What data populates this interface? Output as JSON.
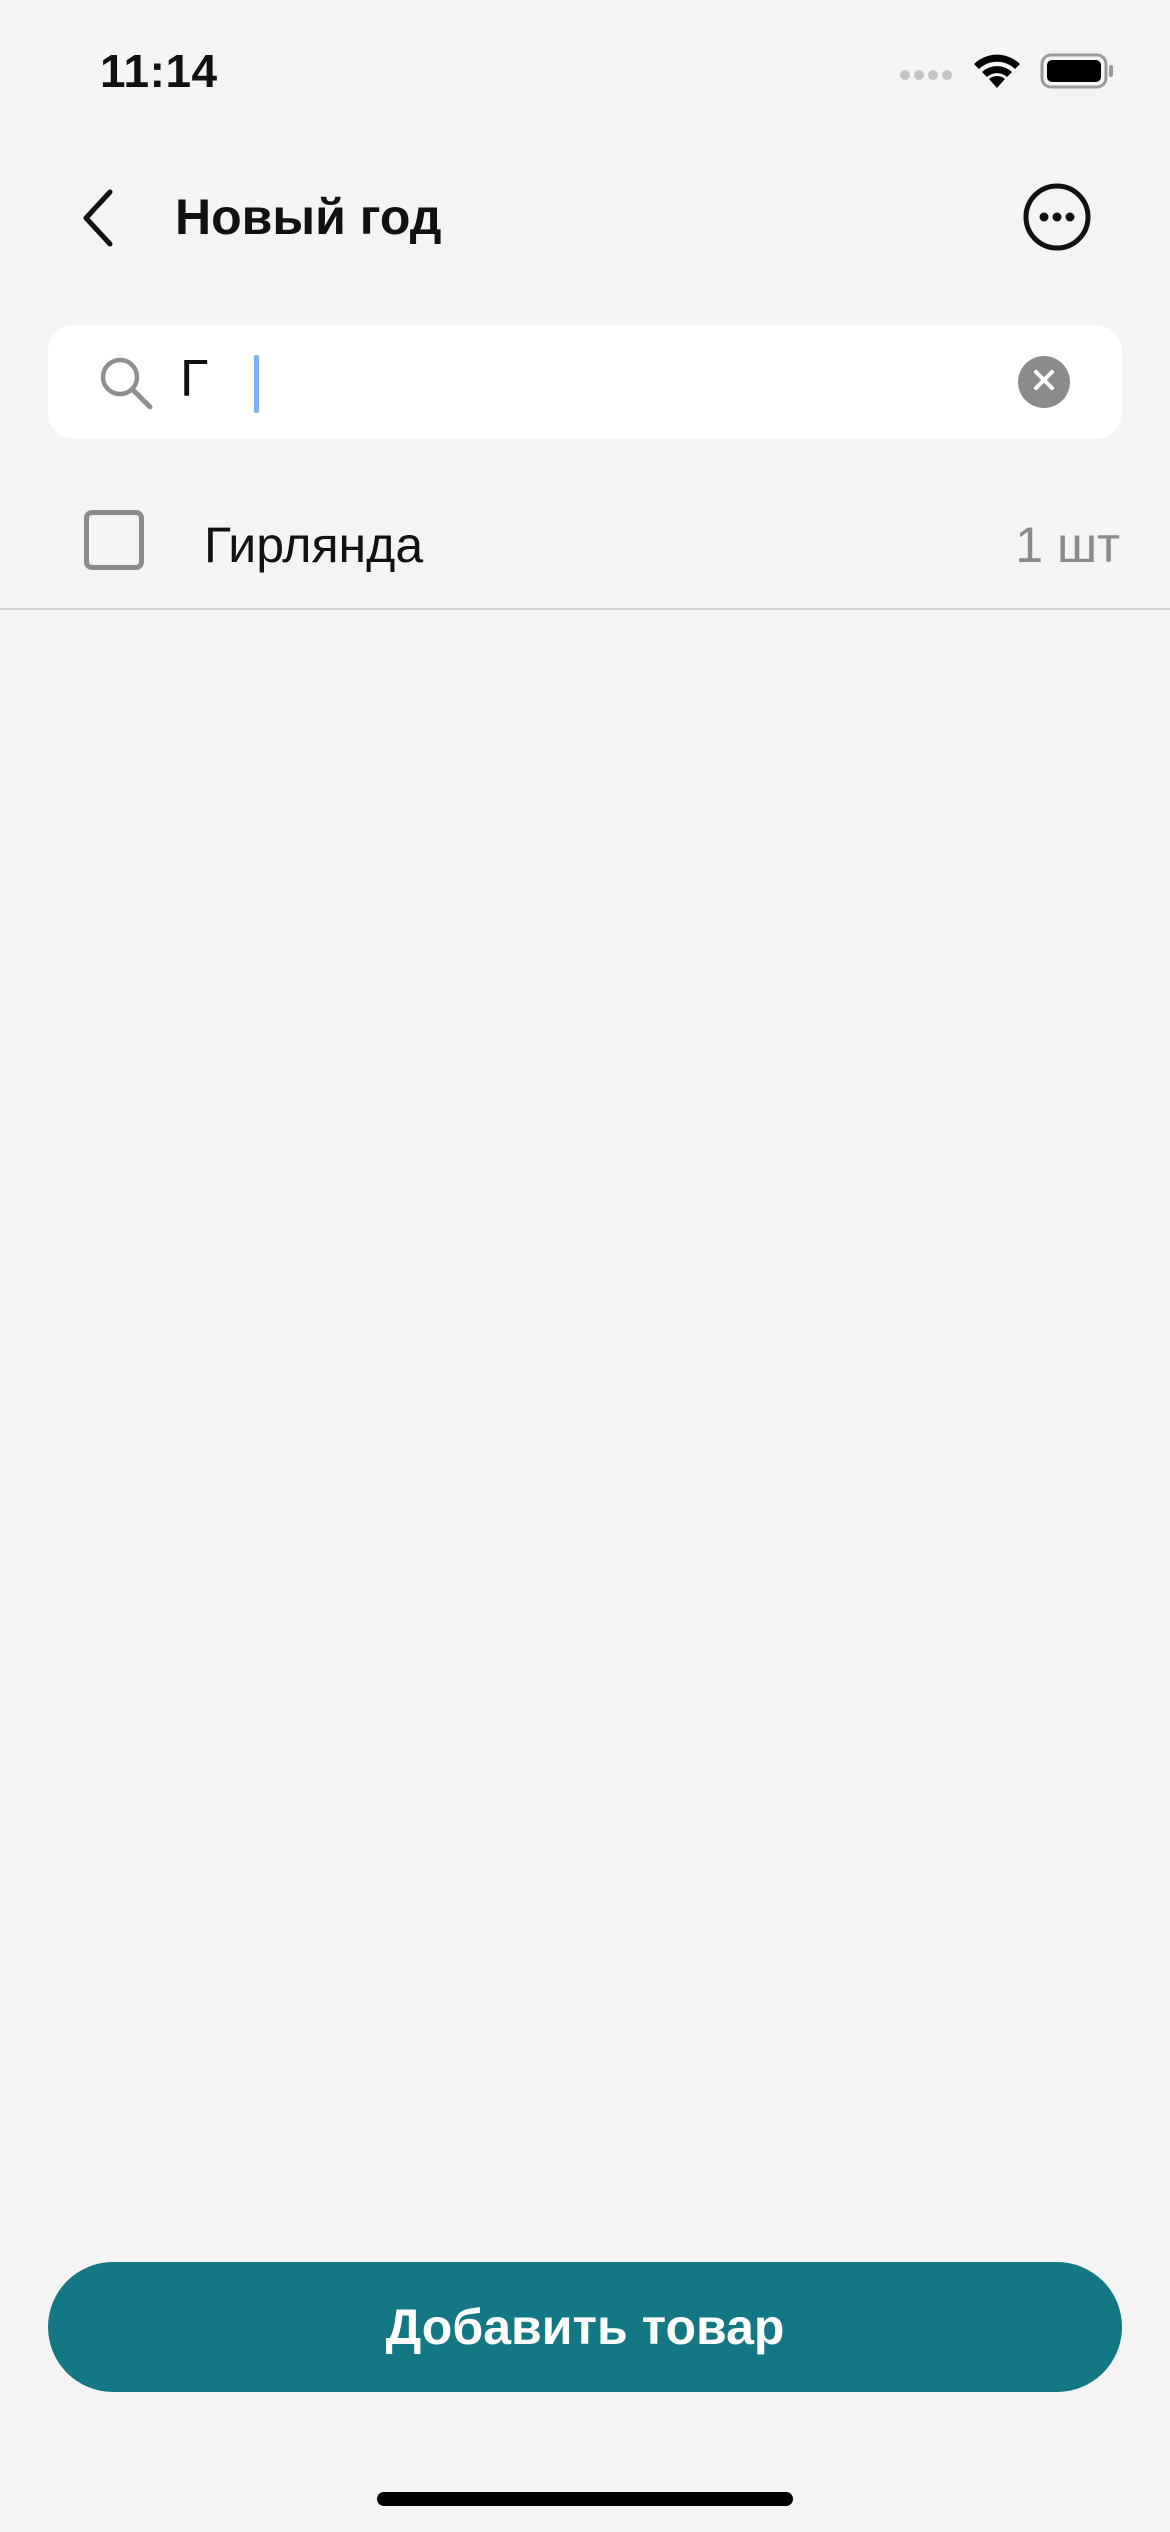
{
  "status_bar": {
    "time": "11:14",
    "icons": [
      "signal-icon",
      "wifi-icon",
      "battery-icon"
    ]
  },
  "header": {
    "title": "Новый год",
    "back_icon": "chevron-left-icon",
    "more_icon": "ellipsis-circle-icon"
  },
  "search": {
    "value": "Г",
    "icon": "search-icon",
    "clear_icon": "clear-icon"
  },
  "items": [
    {
      "name": "Гирлянда",
      "quantity": "1 шт",
      "checked": false
    }
  ],
  "footer": {
    "add_label": "Добавить товар"
  },
  "colors": {
    "background": "#f4f4f4",
    "accent": "#137884",
    "secondary_text": "#8a8a8f"
  }
}
